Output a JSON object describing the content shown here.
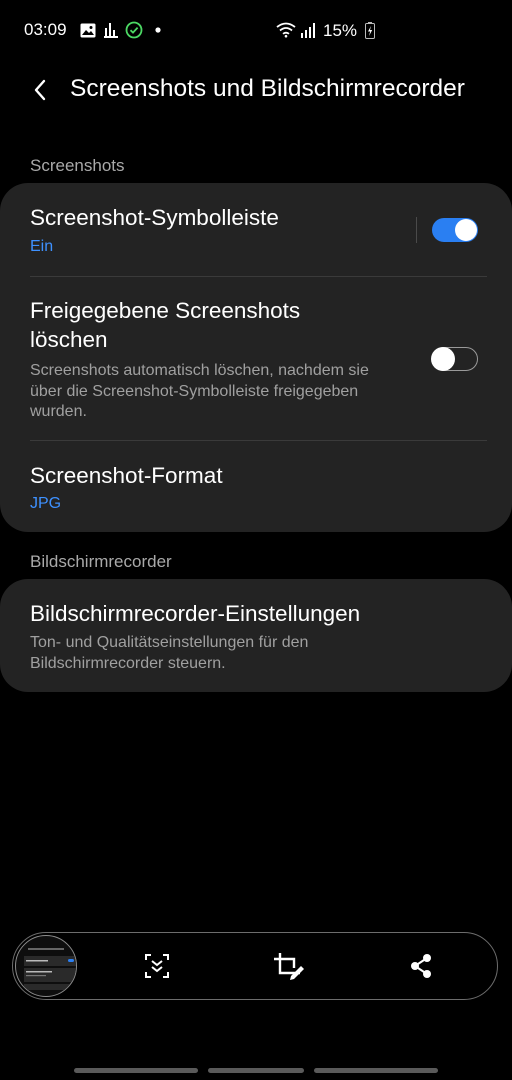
{
  "status_bar": {
    "time": "03:09",
    "battery": "15%",
    "icons": [
      "image-icon",
      "activity-bars-icon",
      "check-circle-icon",
      "dot-icon",
      "wifi-icon",
      "signal-icon",
      "battery-charging-icon"
    ]
  },
  "header": {
    "back_icon": "chevron-left-icon",
    "title": "Screenshots und Bildschirmrecorder"
  },
  "sections": {
    "screenshots": {
      "label": "Screenshots",
      "items": [
        {
          "title": "Screenshot-Symbolleiste",
          "value": "Ein",
          "toggle": true
        },
        {
          "title_line1": "Freigegebene Screenshots",
          "title_line2": "löschen",
          "desc_line1": "Screenshots automatisch löschen, nachdem sie",
          "desc_line2": "über die Screenshot-Symbolleiste freigegeben",
          "desc_line3": "wurden.",
          "toggle": false
        },
        {
          "title": "Screenshot-Format",
          "value": "JPG"
        }
      ]
    },
    "recorder": {
      "label": "Bildschirmrecorder",
      "items": [
        {
          "title": "Bildschirmrecorder-Einstellungen",
          "desc_line1": "Ton- und Qualitätseinstellungen für den",
          "desc_line2": "Bildschirmrecorder steuern."
        }
      ]
    }
  },
  "toolbar": {
    "buttons": [
      "scroll-capture-icon",
      "crop-edit-icon",
      "share-icon"
    ]
  },
  "colors": {
    "accent": "#3e91ff",
    "toggle_on": "#2a7ff2",
    "card_bg": "#232323",
    "background": "#000000"
  }
}
